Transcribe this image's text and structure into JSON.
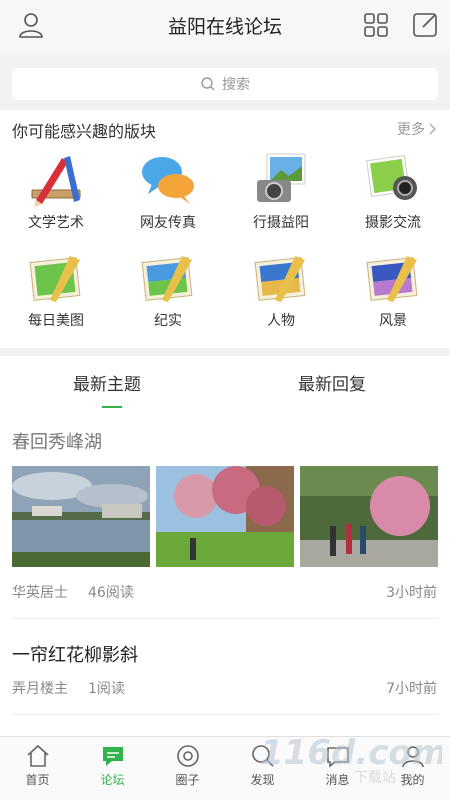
{
  "header": {
    "title": "益阳在线论坛"
  },
  "search": {
    "placeholder": "搜索"
  },
  "boards": {
    "title": "你可能感兴趣的版块",
    "more": "更多",
    "items": [
      {
        "label": "文学艺术",
        "icon": "pencil-ruler-icon"
      },
      {
        "label": "网友传真",
        "icon": "chat-bubbles-icon"
      },
      {
        "label": "行摄益阳",
        "icon": "camera-icon"
      },
      {
        "label": "摄影交流",
        "icon": "lens-icon"
      },
      {
        "label": "每日美图",
        "icon": "landscape-picture-icon"
      },
      {
        "label": "纪实",
        "icon": "landscape-picture-icon"
      },
      {
        "label": "人物",
        "icon": "landscape-picture-icon"
      },
      {
        "label": "风景",
        "icon": "landscape-picture-icon"
      }
    ]
  },
  "feed": {
    "tabs": [
      "最新主题",
      "最新回复"
    ],
    "active_tab": "最新主题",
    "posts": [
      {
        "title": "春回秀峰湖",
        "author": "华英居士",
        "reads": "46阅读",
        "time": "3小时前"
      },
      {
        "title": "一帘红花柳影斜",
        "author": "弄月楼主",
        "reads": "1阅读",
        "time": "7小时前"
      }
    ]
  },
  "tabbar": {
    "items": [
      {
        "label": "首页",
        "icon": "home-icon"
      },
      {
        "label": "论坛",
        "icon": "forum-icon"
      },
      {
        "label": "圈子",
        "icon": "circle-icon"
      },
      {
        "label": "发现",
        "icon": "discover-icon"
      },
      {
        "label": "消息",
        "icon": "message-icon"
      },
      {
        "label": "我的",
        "icon": "profile-icon"
      }
    ],
    "active": "论坛"
  },
  "watermark": {
    "text": "116d.com",
    "sub": "下载站"
  },
  "colors": {
    "accent": "#31b24a",
    "background": "#f2f2f2"
  }
}
